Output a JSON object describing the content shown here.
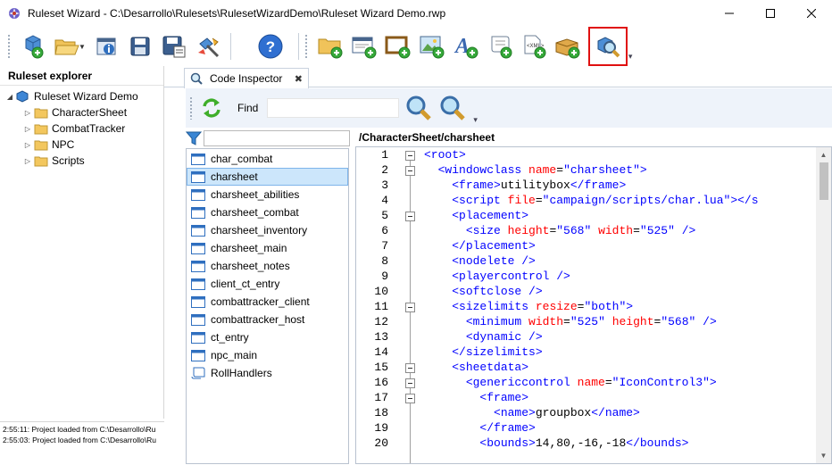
{
  "window": {
    "title": "Ruleset Wizard - C:\\Desarrollo\\Rulesets\\RulesetWizardDemo\\Ruleset Wizard Demo.rwp"
  },
  "toolbar": {
    "buttons": [
      {
        "name": "new-project-icon"
      },
      {
        "name": "open-project-icon"
      },
      {
        "name": "project-properties-icon"
      },
      {
        "name": "save-icon"
      },
      {
        "name": "save-as-icon"
      },
      {
        "name": "build-tools-icon"
      },
      {
        "name": "help-icon"
      },
      {
        "name": "new-folder-icon"
      },
      {
        "name": "new-window-class-icon"
      },
      {
        "name": "new-frame-icon"
      },
      {
        "name": "new-image-icon"
      },
      {
        "name": "new-font-icon"
      },
      {
        "name": "new-script-icon"
      },
      {
        "name": "new-xml-icon"
      },
      {
        "name": "new-package-icon"
      },
      {
        "name": "code-inspector-icon"
      }
    ],
    "highlighted": "code-inspector-icon"
  },
  "explorer": {
    "title": "Ruleset explorer",
    "root": "Ruleset Wizard Demo",
    "folders": [
      "CharacterSheet",
      "CombatTracker",
      "NPC",
      "Scripts"
    ]
  },
  "log": {
    "lines": [
      "2:55:11: Project loaded from C:\\Desarrollo\\Ru",
      "2:55:03: Project loaded from C:\\Desarrollo\\Ru"
    ]
  },
  "tab": {
    "label": "Code Inspector",
    "close": "✖"
  },
  "inspector": {
    "find_label": "Find",
    "find_value": "",
    "filter_value": ""
  },
  "files": {
    "items": [
      {
        "label": "char_combat",
        "kind": "window"
      },
      {
        "label": "charsheet",
        "kind": "window",
        "selected": true
      },
      {
        "label": "charsheet_abilities",
        "kind": "window"
      },
      {
        "label": "charsheet_combat",
        "kind": "window"
      },
      {
        "label": "charsheet_inventory",
        "kind": "window"
      },
      {
        "label": "charsheet_main",
        "kind": "window"
      },
      {
        "label": "charsheet_notes",
        "kind": "window"
      },
      {
        "label": "client_ct_entry",
        "kind": "window"
      },
      {
        "label": "combattracker_client",
        "kind": "window"
      },
      {
        "label": "combattracker_host",
        "kind": "window"
      },
      {
        "label": "ct_entry",
        "kind": "window"
      },
      {
        "label": "npc_main",
        "kind": "window"
      },
      {
        "label": "RollHandlers",
        "kind": "script"
      }
    ]
  },
  "editor": {
    "path": "/CharacterSheet/charsheet",
    "line_numbers": [
      "1",
      "2",
      "3",
      "4",
      "5",
      "6",
      "7",
      "8",
      "9",
      "10",
      "11",
      "12",
      "13",
      "14",
      "15",
      "16",
      "17",
      "18",
      "19",
      "20"
    ],
    "lines": [
      [
        [
          "tg",
          "<root>"
        ]
      ],
      [
        [
          "tx",
          "  "
        ],
        [
          "tg",
          "<windowclass "
        ],
        [
          "at",
          "name"
        ],
        [
          "tx",
          "="
        ],
        [
          "av",
          "\"charsheet\""
        ],
        [
          "tg",
          ">"
        ]
      ],
      [
        [
          "tx",
          "    "
        ],
        [
          "tg",
          "<frame>"
        ],
        [
          "tx",
          "utilitybox"
        ],
        [
          "tg",
          "</frame>"
        ]
      ],
      [
        [
          "tx",
          "    "
        ],
        [
          "tg",
          "<script "
        ],
        [
          "at",
          "file"
        ],
        [
          "tx",
          "="
        ],
        [
          "av",
          "\"campaign/scripts/char.lua\""
        ],
        [
          "tg",
          "></s"
        ]
      ],
      [
        [
          "tx",
          "    "
        ],
        [
          "tg",
          "<placement>"
        ]
      ],
      [
        [
          "tx",
          "      "
        ],
        [
          "tg",
          "<size "
        ],
        [
          "at",
          "height"
        ],
        [
          "tx",
          "="
        ],
        [
          "av",
          "\"568\""
        ],
        [
          "tx",
          " "
        ],
        [
          "at",
          "width"
        ],
        [
          "tx",
          "="
        ],
        [
          "av",
          "\"525\""
        ],
        [
          "tx",
          " "
        ],
        [
          "tg",
          "/>"
        ]
      ],
      [
        [
          "tx",
          "    "
        ],
        [
          "tg",
          "</placement>"
        ]
      ],
      [
        [
          "tx",
          "    "
        ],
        [
          "tg",
          "<nodelete />"
        ]
      ],
      [
        [
          "tx",
          "    "
        ],
        [
          "tg",
          "<playercontrol />"
        ]
      ],
      [
        [
          "tx",
          "    "
        ],
        [
          "tg",
          "<softclose />"
        ]
      ],
      [
        [
          "tx",
          "    "
        ],
        [
          "tg",
          "<sizelimits "
        ],
        [
          "at",
          "resize"
        ],
        [
          "tx",
          "="
        ],
        [
          "av",
          "\"both\""
        ],
        [
          "tg",
          ">"
        ]
      ],
      [
        [
          "tx",
          "      "
        ],
        [
          "tg",
          "<minimum "
        ],
        [
          "at",
          "width"
        ],
        [
          "tx",
          "="
        ],
        [
          "av",
          "\"525\""
        ],
        [
          "tx",
          " "
        ],
        [
          "at",
          "height"
        ],
        [
          "tx",
          "="
        ],
        [
          "av",
          "\"568\""
        ],
        [
          "tx",
          " "
        ],
        [
          "tg",
          "/>"
        ]
      ],
      [
        [
          "tx",
          "      "
        ],
        [
          "tg",
          "<dynamic />"
        ]
      ],
      [
        [
          "tx",
          "    "
        ],
        [
          "tg",
          "</sizelimits>"
        ]
      ],
      [
        [
          "tx",
          "    "
        ],
        [
          "tg",
          "<sheetdata>"
        ]
      ],
      [
        [
          "tx",
          "      "
        ],
        [
          "tg",
          "<genericcontrol "
        ],
        [
          "at",
          "name"
        ],
        [
          "tx",
          "="
        ],
        [
          "av",
          "\"IconControl3\""
        ],
        [
          "tg",
          ">"
        ]
      ],
      [
        [
          "tx",
          "        "
        ],
        [
          "tg",
          "<frame>"
        ]
      ],
      [
        [
          "tx",
          "          "
        ],
        [
          "tg",
          "<name>"
        ],
        [
          "tx",
          "groupbox"
        ],
        [
          "tg",
          "</name>"
        ]
      ],
      [
        [
          "tx",
          "        "
        ],
        [
          "tg",
          "</frame>"
        ]
      ],
      [
        [
          "tx",
          "        "
        ],
        [
          "tg",
          "<bounds>"
        ],
        [
          "tx",
          "14,80,-16,-18"
        ],
        [
          "tg",
          "</bounds>"
        ]
      ]
    ],
    "fold_lines": [
      1,
      2,
      5,
      11,
      15,
      16,
      17
    ]
  },
  "colors": {
    "tag": "#0000ff",
    "attribute": "#ff0000",
    "selection": "#cce6fb",
    "highlight_box": "#e01010"
  }
}
